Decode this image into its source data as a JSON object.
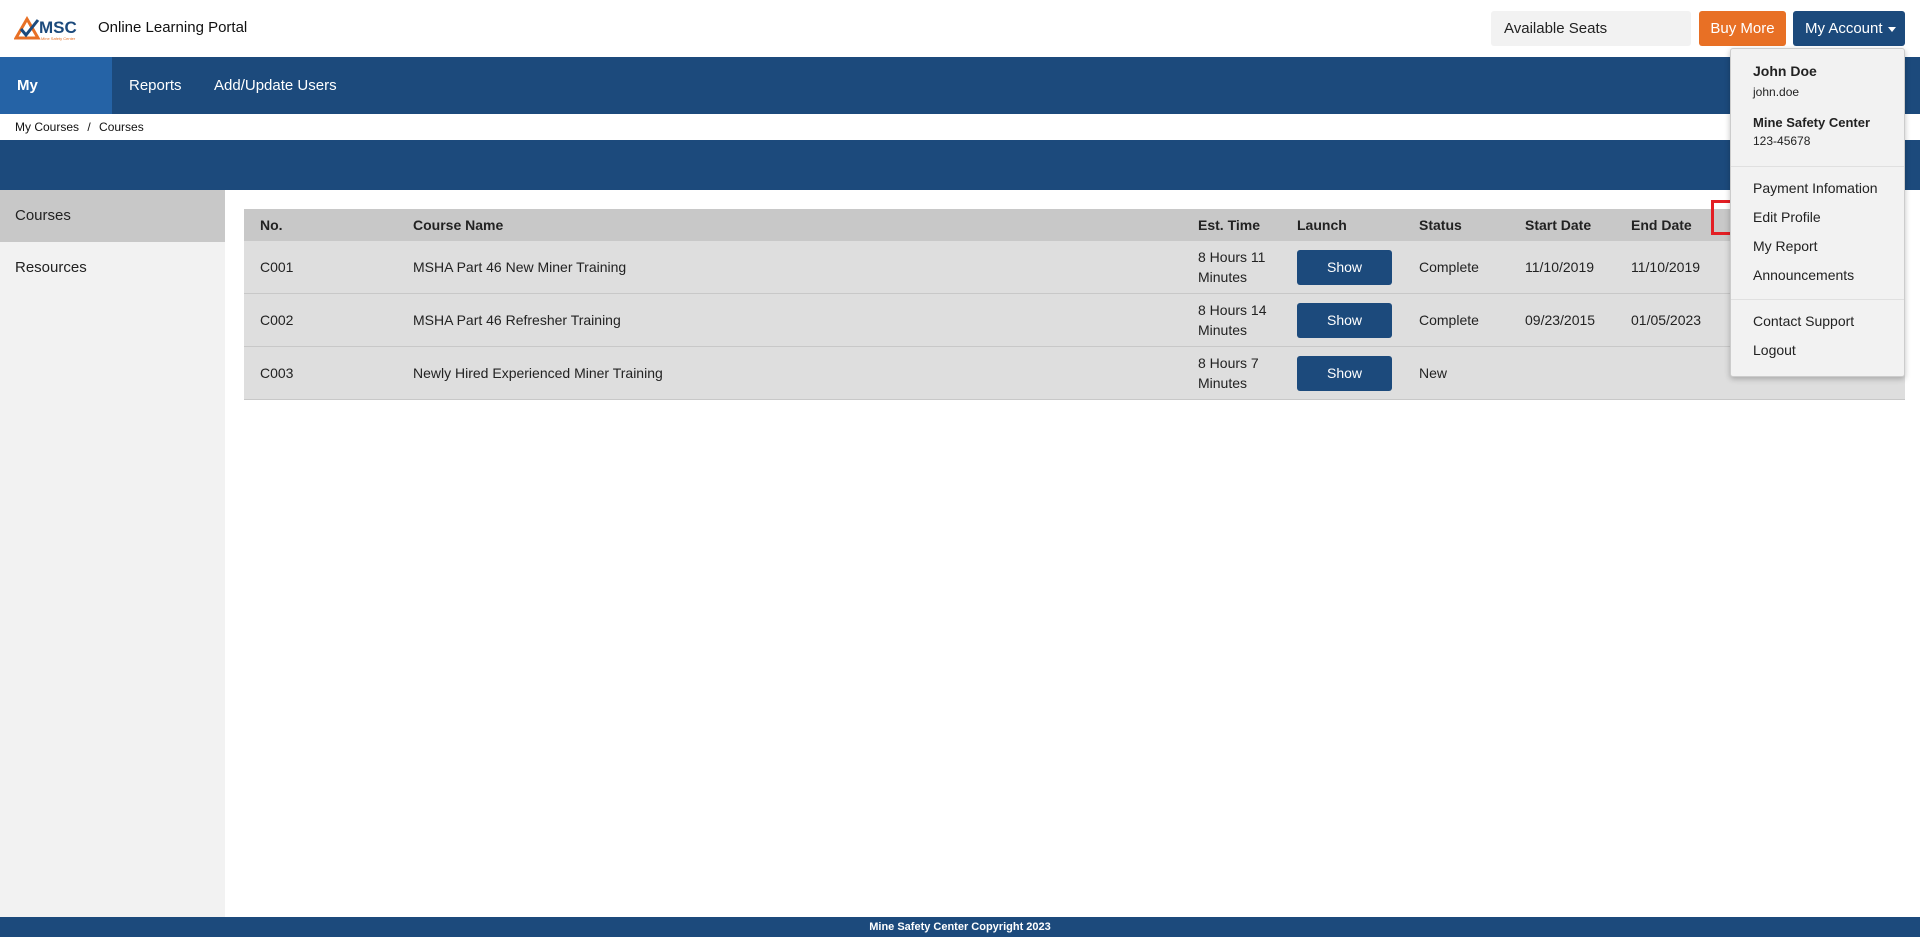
{
  "header": {
    "logo_text": "MSC",
    "logo_subtext": "Mine Safety Center",
    "portal_title": "Online Learning Portal",
    "available_seats": "Available Seats",
    "buy_more": "Buy More",
    "my_account": "My Account"
  },
  "nav": {
    "items": [
      {
        "label": "My Courses",
        "active": true
      },
      {
        "label": "Reports"
      },
      {
        "label": "Add/Update Users"
      }
    ]
  },
  "breadcrumb": [
    "My Courses",
    "/",
    "Courses"
  ],
  "sidebar": {
    "items": [
      {
        "label": "Courses",
        "active": true
      },
      {
        "label": "Resources"
      }
    ]
  },
  "table": {
    "headers": [
      "No.",
      "Course Name",
      "Est. Time",
      "Launch",
      "Status",
      "Start Date",
      "End Date"
    ],
    "rows": [
      {
        "no": "C001",
        "name": "MSHA Part 46 New Miner Training",
        "time": "8 Hours 11 Minutes",
        "launch": "Show",
        "status": "Complete",
        "start": "11/10/2019",
        "end": "11/10/2019"
      },
      {
        "no": "C002",
        "name": "MSHA Part 46 Refresher Training",
        "time": "8 Hours 14 Minutes",
        "launch": "Show",
        "status": "Complete",
        "start": "09/23/2015",
        "end": "01/05/2023"
      },
      {
        "no": "C003",
        "name": "Newly Hired Experienced Miner Training",
        "time": "8 Hours 7 Minutes",
        "launch": "Show",
        "status": "New",
        "start": "",
        "end": ""
      }
    ]
  },
  "dropdown": {
    "name": "John Doe",
    "username": "john.doe",
    "company": "Mine Safety Center",
    "company_id": "123-45678",
    "items": [
      "Payment Infomation",
      "Edit Profile",
      "My Report",
      "Announcements",
      "Contact Support",
      "Logout"
    ]
  },
  "footer": "Mine Safety Center Copyright 2023",
  "colors": {
    "primary": "#1c4a7c",
    "active_nav": "#2563a6",
    "buy": "#e87025",
    "highlight": "#e31e24"
  }
}
